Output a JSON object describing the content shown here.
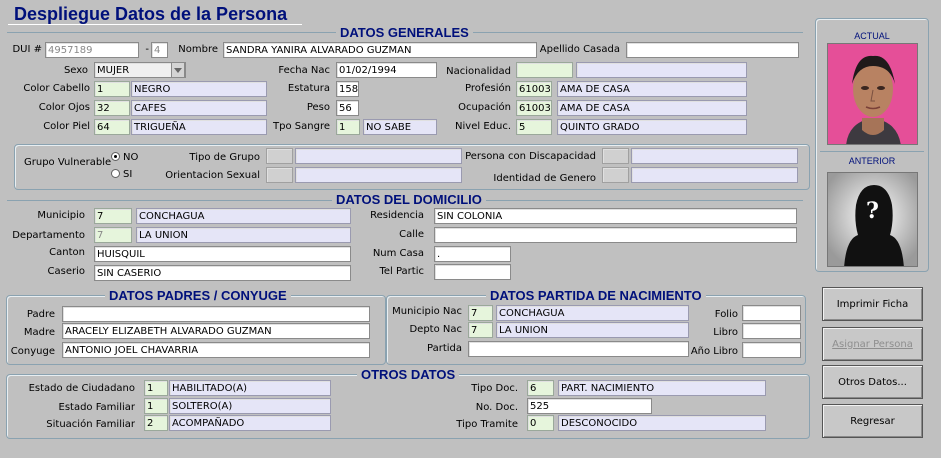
{
  "window_title": "Despliegue Datos de la Persona",
  "sections": {
    "generales": "DATOS GENERALES",
    "domicilio": "DATOS DEL DOMICILIO",
    "padres": "DATOS PADRES / CONYUGE",
    "partida": "DATOS PARTIDA DE NACIMIENTO",
    "otros": "OTROS DATOS"
  },
  "general": {
    "dui_label": "DUI #",
    "dui": "4957189",
    "dui_sep": "-",
    "dui_digit": "4",
    "nombre_label": "Nombre",
    "nombre": "SANDRA YANIRA ALVARADO GUZMAN",
    "apellido_casada_label": "Apellido Casada",
    "apellido_casada": "",
    "sexo_label": "Sexo",
    "sexo": "MUJER",
    "fecha_nac_label": "Fecha Nac",
    "fecha_nac": "01/02/1994",
    "nacionalidad_label": "Nacionalidad",
    "nacionalidad_code": "",
    "nacionalidad": "",
    "color_cabello_label": "Color Cabello",
    "color_cabello_code": "1",
    "color_cabello": "NEGRO",
    "estatura_label": "Estatura",
    "estatura": "158",
    "profesion_label": "Profesión",
    "profesion_code": "61003",
    "profesion": "AMA DE CASA",
    "color_ojos_label": "Color Ojos",
    "color_ojos_code": "32",
    "color_ojos": "CAFES",
    "peso_label": "Peso",
    "peso": "56",
    "ocupacion_label": "Ocupación",
    "ocupacion_code": "61003",
    "ocupacion": "AMA DE CASA",
    "color_piel_label": "Color Piel",
    "color_piel_code": "64",
    "color_piel": "TRIGUEÑA",
    "tpo_sangre_label": "Tpo Sangre",
    "tpo_sangre_code": "1",
    "tpo_sangre": "NO SABE",
    "nivel_educ_label": "Nivel Educ.",
    "nivel_educ_code": "5",
    "nivel_educ": "QUINTO GRADO"
  },
  "vulnerable": {
    "grupo_label": "Grupo Vulnerable",
    "no_label": "NO",
    "si_label": "SI",
    "selected": "NO",
    "tipo_grupo_label": "Tipo de Grupo",
    "orientacion_label": "Orientacion Sexual",
    "discapacidad_label": "Persona con Discapacidad",
    "identidad_label": "Identidad de Genero"
  },
  "domicilio": {
    "municipio_label": "Municipio",
    "municipio_code": "7",
    "municipio": "CONCHAGUA",
    "departamento_label": "Departamento",
    "departamento_code": "7",
    "departamento": "LA UNION",
    "canton_label": "Canton",
    "canton": "HUISQUIL",
    "caserio_label": "Caserio",
    "caserio": "SIN CASERIO",
    "residencia_label": "Residencia",
    "residencia": "SIN COLONIA",
    "calle_label": "Calle",
    "calle": "",
    "num_casa_label": "Num Casa",
    "num_casa": ".",
    "tel_partic_label": "Tel Partic",
    "tel_partic": ""
  },
  "padres": {
    "padre_label": "Padre",
    "padre": "",
    "madre_label": "Madre",
    "madre": "ARACELY ELIZABETH ALVARADO GUZMAN",
    "conyuge_label": "Conyuge",
    "conyuge": "ANTONIO JOEL CHAVARRIA"
  },
  "partida": {
    "municipio_label": "Municipio Nac",
    "municipio_code": "7",
    "municipio": "CONCHAGUA",
    "depto_label": "Depto Nac",
    "depto_code": "7",
    "depto": "LA UNION",
    "partida_label": "Partida",
    "partida": "",
    "folio_label": "Folio",
    "folio": "",
    "libro_label": "Libro",
    "libro": "",
    "anio_libro_label": "Año Libro",
    "anio_libro": ""
  },
  "otros": {
    "estado_ciudadano_label": "Estado de Ciudadano",
    "estado_ciudadano_code": "1",
    "estado_ciudadano": "HABILITADO(A)",
    "estado_familiar_label": "Estado Familiar",
    "estado_familiar_code": "1",
    "estado_familiar": "SOLTERO(A)",
    "situacion_familiar_label": "Situación Familiar",
    "situacion_familiar_code": "2",
    "situacion_familiar": "ACOMPAÑADO",
    "tipo_doc_label": "Tipo Doc.",
    "tipo_doc_code": "6",
    "tipo_doc": "PART. NACIMIENTO",
    "no_doc_label": "No. Doc.",
    "no_doc": "525",
    "tipo_tramite_label": "Tipo Tramite",
    "tipo_tramite_code": "0",
    "tipo_tramite": "DESCONOCIDO"
  },
  "photos": {
    "actual_label": "ACTUAL",
    "anterior_label": "ANTERIOR",
    "placeholder_glyph": "?"
  },
  "buttons": {
    "imprimir": "Imprimir Ficha",
    "asignar": "Asignar Persona",
    "otros": "Otros Datos...",
    "regresar": "Regresar"
  },
  "colors": {
    "title": "#00107b",
    "code_bg": "#e6f5dc",
    "desc_bg": "#e5e5f7",
    "photo_bg": "#e8509a"
  }
}
